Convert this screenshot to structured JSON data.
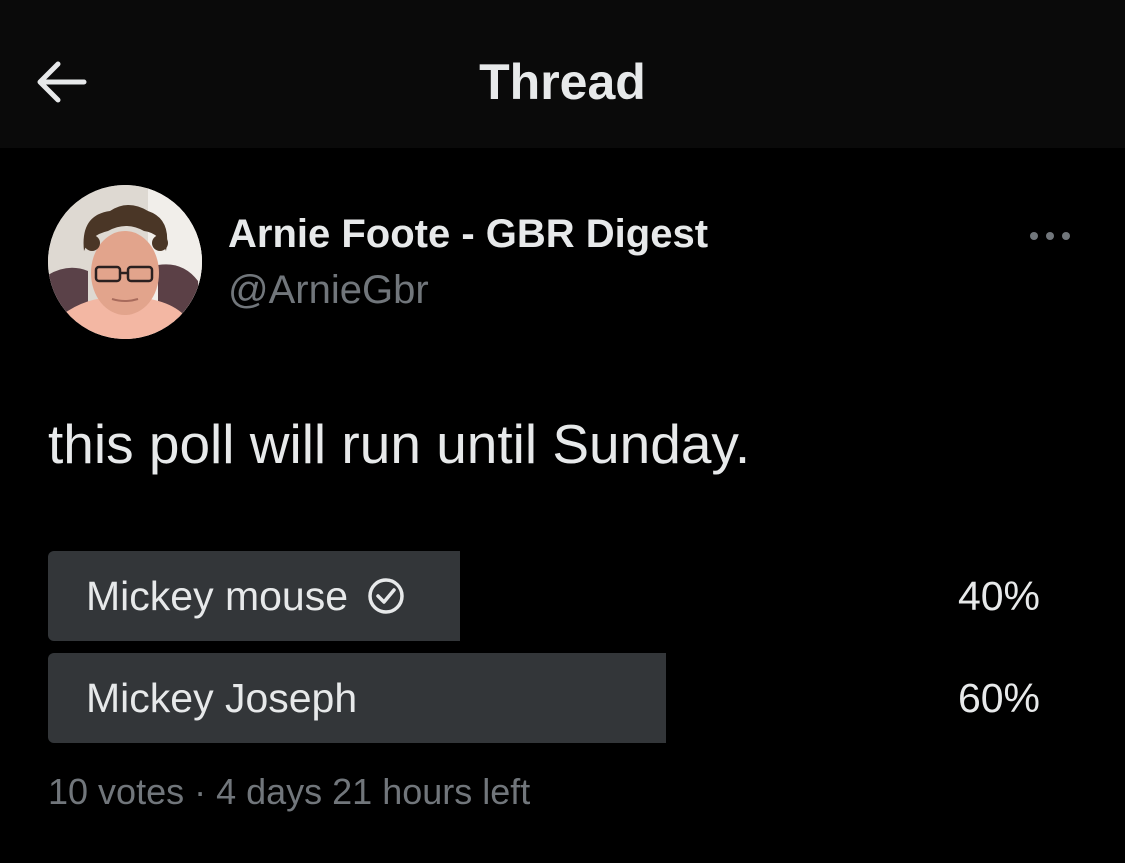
{
  "header": {
    "title": "Thread",
    "back_icon": "arrow-left-icon"
  },
  "author": {
    "display_name": "Arnie Foote - GBR Digest",
    "handle": "@ArnieGbr",
    "avatar": "profile-photo"
  },
  "tweet": {
    "text": "this poll will run until Sunday.",
    "more_icon": "more-horizontal-icon"
  },
  "poll": {
    "options": [
      {
        "label": "Mickey mouse",
        "percent_label": "40%",
        "share": 0.4,
        "voted": true,
        "voted_icon": "check-circle-icon"
      },
      {
        "label": "Mickey Joseph",
        "percent_label": "60%",
        "share": 0.6,
        "voted": false
      }
    ],
    "meta": "10 votes · 4 days 21 hours left"
  },
  "colors": {
    "background": "#000000",
    "header_background": "#0a0a0a",
    "text_primary": "#e7e9ea",
    "text_secondary": "#71767b",
    "poll_bar": "#333639"
  }
}
